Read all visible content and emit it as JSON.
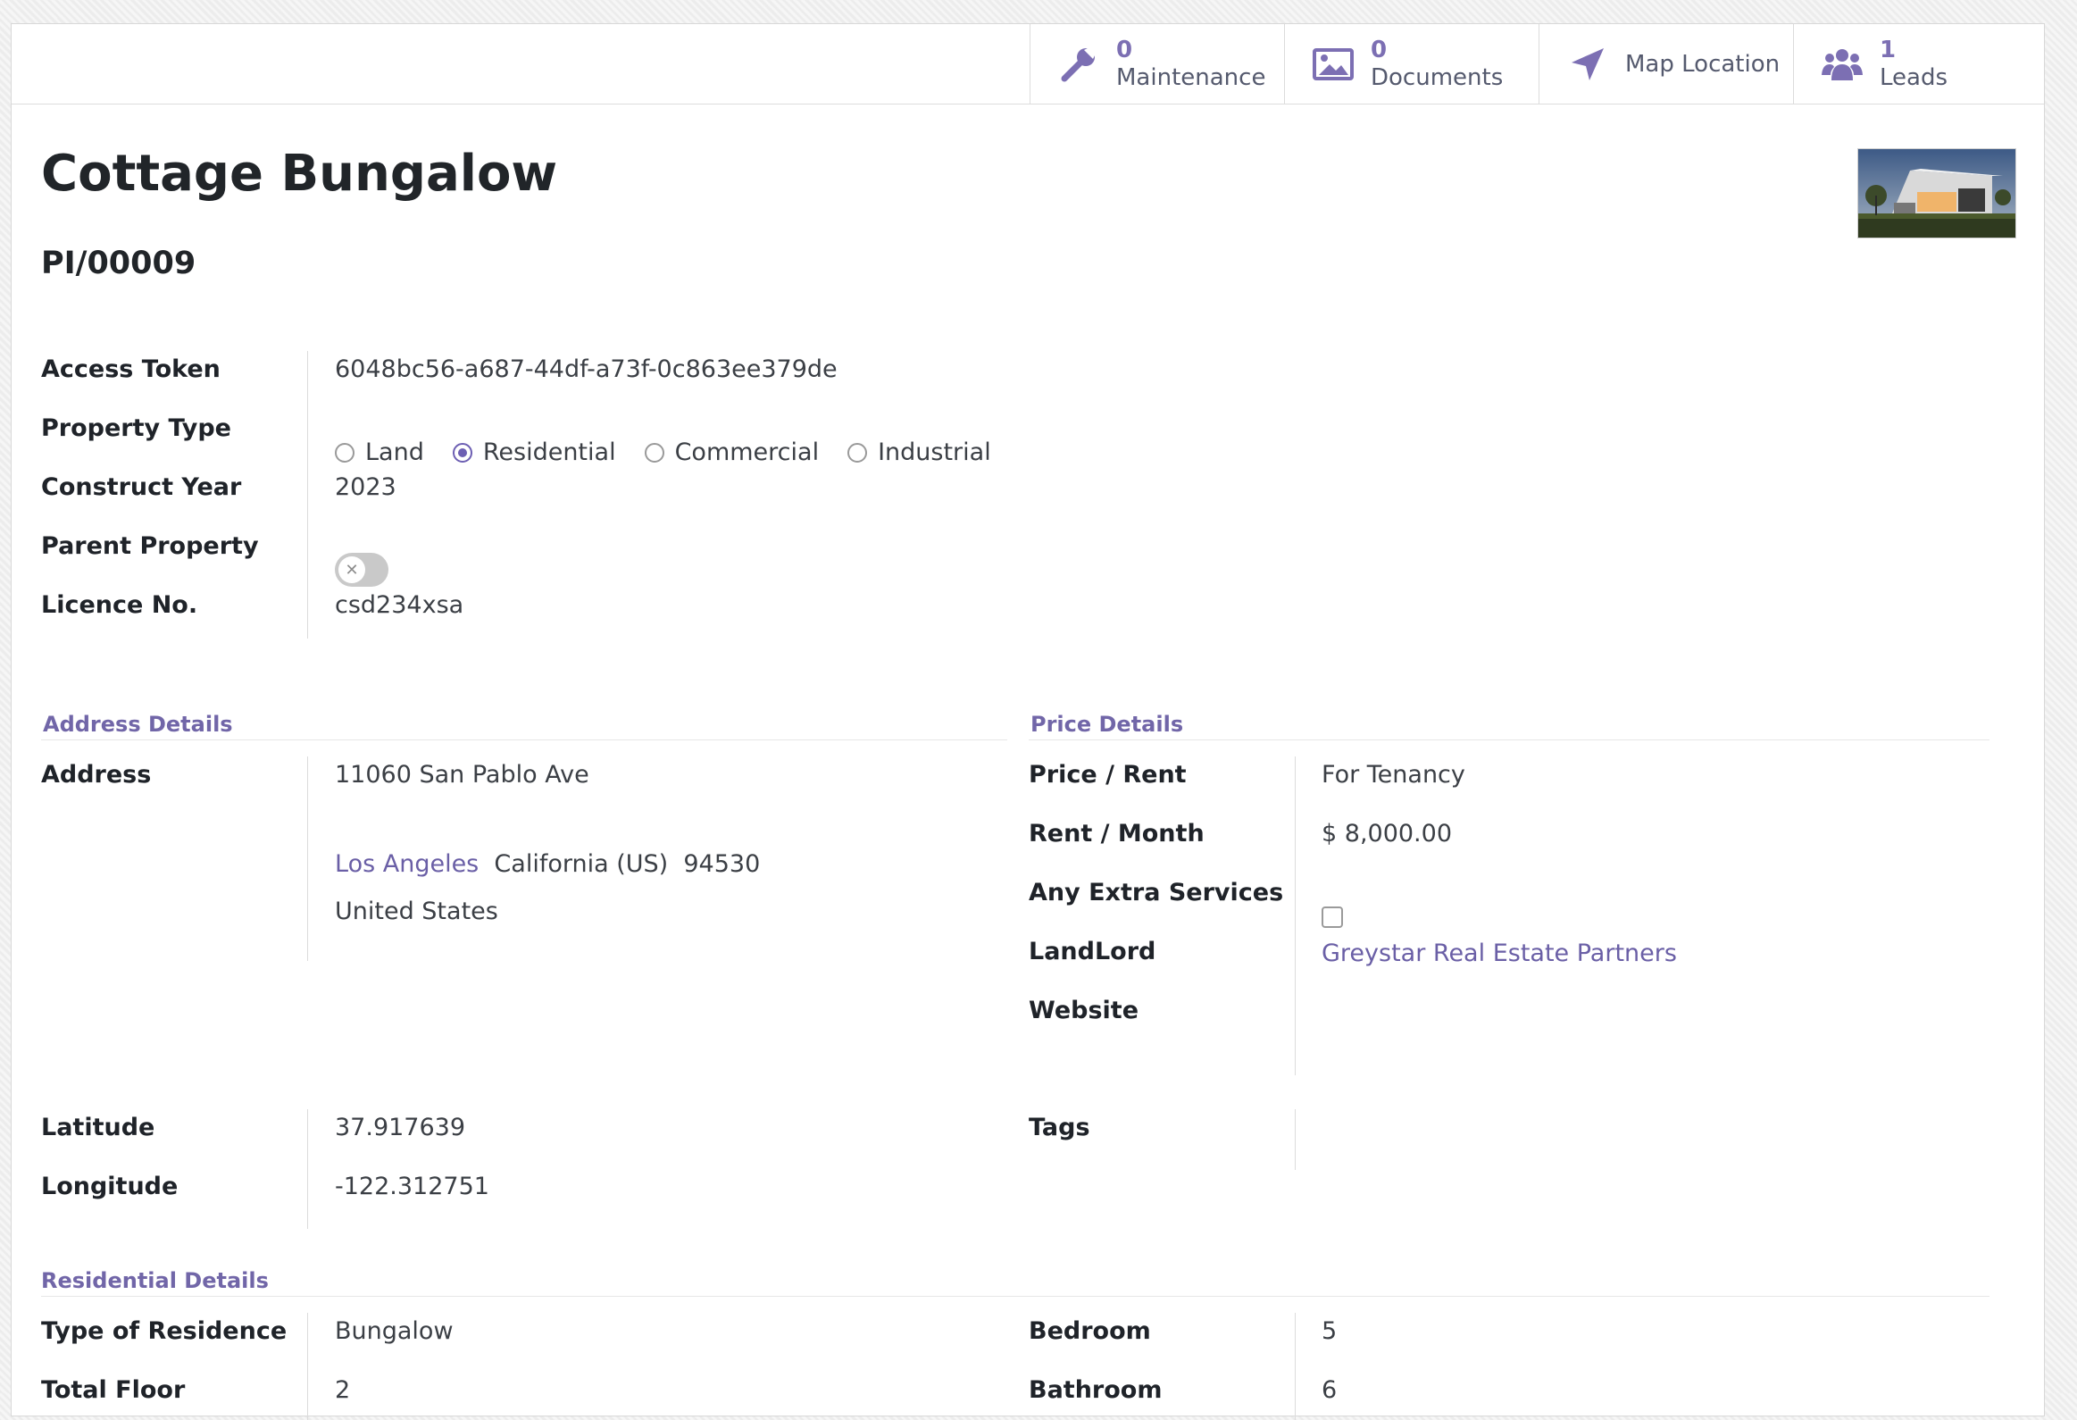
{
  "smart_buttons": {
    "maintenance": {
      "count": "0",
      "label": "Maintenance",
      "icon": "wrench-icon"
    },
    "documents": {
      "count": "0",
      "label": "Documents",
      "icon": "image-icon"
    },
    "map_location": {
      "label": "Map Location",
      "icon": "location-arrow-icon"
    },
    "leads": {
      "count": "1",
      "label": "Leads",
      "icon": "users-icon"
    }
  },
  "record": {
    "name": "Cottage Bungalow",
    "reference": "PI/00009"
  },
  "general": {
    "access_token_label": "Access Token",
    "access_token_value": "6048bc56-a687-44df-a73f-0c863ee379de",
    "property_type_label": "Property Type",
    "property_type_options": [
      "Land",
      "Residential",
      "Commercial",
      "Industrial"
    ],
    "property_type_selected": "Residential",
    "construct_year_label": "Construct Year",
    "construct_year_value": "2023",
    "parent_property_label": "Parent Property",
    "parent_property_value": false,
    "licence_label": "Licence No.",
    "licence_value": "csd234xsa"
  },
  "address_details": {
    "section_title": "Address Details",
    "address_label": "Address",
    "street": "11060 San Pablo Ave",
    "city": "Los Angeles",
    "state": "California (US)",
    "zip": "94530",
    "country": "United States",
    "latitude_label": "Latitude",
    "latitude_value": "37.917639",
    "longitude_label": "Longitude",
    "longitude_value": "-122.312751"
  },
  "price_details": {
    "section_title": "Price Details",
    "price_rent_label": "Price / Rent",
    "price_rent_value": "For Tenancy",
    "rent_month_label": "Rent / Month",
    "rent_month_value": "$ 8,000.00",
    "extra_services_label": "Any Extra Services",
    "extra_services_checked": false,
    "landlord_label": "LandLord",
    "landlord_value": "Greystar Real Estate Partners",
    "website_label": "Website",
    "website_value": "",
    "tags_label": "Tags"
  },
  "residential_details": {
    "section_title": "Residential Details",
    "type_label": "Type of Residence",
    "type_value": "Bungalow",
    "total_floor_label": "Total Floor",
    "total_floor_value": "2",
    "bedroom_label": "Bedroom",
    "bedroom_value": "5",
    "bathroom_label": "Bathroom",
    "bathroom_value": "6"
  },
  "colors": {
    "accent": "#6d5fb3",
    "link": "#6a5fa6",
    "section": "#7166a8"
  }
}
